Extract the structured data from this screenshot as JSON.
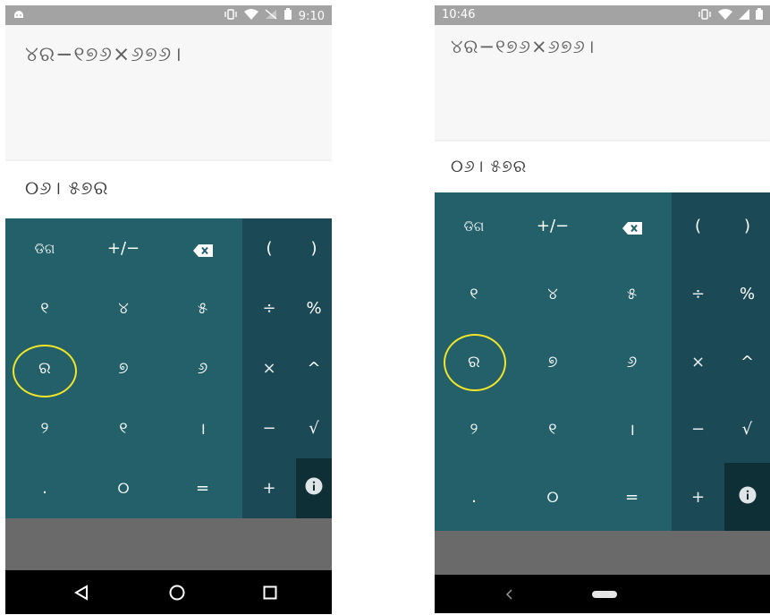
{
  "left": {
    "status": {
      "time": "9:10"
    },
    "expression": "୪ର−୧୭୬×୬୭୬।",
    "result": "୦୬। ୫୭ର",
    "keys": {
      "clear": "ଡିଗ",
      "sign": "+/−",
      "d7": "୧",
      "d8": "୪",
      "d9": "୫",
      "d4": "ର",
      "d5": "୭",
      "d6": "୬",
      "d1": "୨",
      "d2": "୧",
      "d3": "।",
      "dot": ".",
      "d0": "୦",
      "equals": "=",
      "open_paren": "(",
      "close_paren": ")",
      "divide": "÷",
      "percent": "%",
      "multiply": "×",
      "power": "^",
      "minus": "−",
      "sqrt": "√",
      "plus": "+"
    }
  },
  "right": {
    "status": {
      "time": "10:46"
    },
    "expression": "୪ର−୧୭୬×୬୭୬।",
    "result": "୦୬। ୫୭ର",
    "keys": {
      "clear": "ଡିଗ",
      "sign": "+/−",
      "d7": "୧",
      "d8": "୪",
      "d9": "୫",
      "d4": "ର",
      "d5": "୭",
      "d6": "୬",
      "d1": "୨",
      "d2": "୧",
      "d3": "।",
      "dot": ".",
      "d0": "୦",
      "equals": "=",
      "open_paren": "(",
      "close_paren": ")",
      "divide": "÷",
      "percent": "%",
      "multiply": "×",
      "power": "^",
      "minus": "−",
      "sqrt": "√",
      "plus": "+"
    }
  },
  "icons": {
    "backspace": "backspace-icon",
    "info": "info-icon",
    "back": "back-triangle-icon",
    "home": "home-circle-icon",
    "recents": "recents-square-icon"
  },
  "colors": {
    "numpad": "#23606a",
    "oppad": "#1b4a56",
    "info_cell": "#0f2f36",
    "highlight": "#f2e629",
    "status_bar": "#a3a3a3"
  }
}
